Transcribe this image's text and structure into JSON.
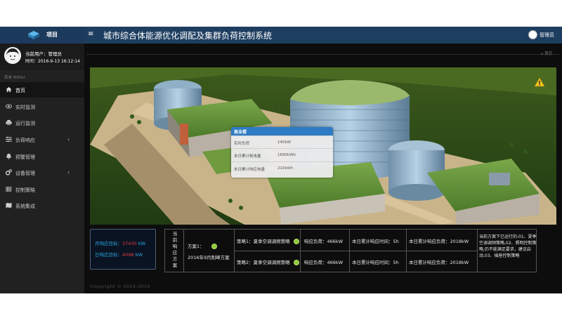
{
  "header": {
    "logo_text": "项目",
    "title": "城市综合体能源优化调配及集群负荷控制系统",
    "user_name": "管理员"
  },
  "sidebar": {
    "current_user": "当前用户：管理员",
    "time": "时间：2016-9-13 16:12:14",
    "menu_heading": "菜单 MENU",
    "items": [
      {
        "label": "首页",
        "icon": "home-icon",
        "active": true
      },
      {
        "label": "实时监测",
        "icon": "eye-icon"
      },
      {
        "label": "运行监测",
        "icon": "print-icon"
      },
      {
        "label": "负荷响应",
        "icon": "sliders-icon",
        "submenu": true
      },
      {
        "label": "预警管理",
        "icon": "bell-icon"
      },
      {
        "label": "设备管理",
        "icon": "cogs-icon",
        "submenu": true
      },
      {
        "label": "控制策略",
        "icon": "barcode-icon"
      },
      {
        "label": "系统集成",
        "icon": "map-icon"
      }
    ]
  },
  "breadcrumb": {
    "home": "首页"
  },
  "popup": {
    "title": "商业楼",
    "rows": [
      {
        "key": "实时负荷",
        "value": "140kW"
      },
      {
        "key": "本日累计耗电量",
        "value": "1690kWh"
      },
      {
        "key": "本日累计响应电量",
        "value": "210kWh"
      }
    ]
  },
  "targets": {
    "monthly_label": "月响应目标：",
    "monthly_value": "37430",
    "monthly_unit": "KW",
    "daily_label": "日响应目标：",
    "daily_value": "4098",
    "daily_unit": "KW"
  },
  "plan": {
    "side_label": "当前响应方案",
    "scheme_label": "方案1：",
    "scheme_sub": "2016年9月削峰方案",
    "strategies": [
      {
        "name": "策略1：夏季空调调频策略",
        "load": "响应负荷：466kW",
        "time": "本日累计响应时间：5h",
        "energy": "本日累计响应负荷：2018kW"
      },
      {
        "name": "策略2：夏季空调调频策略",
        "load": "响应负荷：466kW",
        "time": "本日累计响应时间：5h",
        "energy": "本日累计响应负荷：2018kW"
      }
    ],
    "note": "当前方案下已运行的:01、夏季空调调频策略,02、照明控制策略,仍不能满足要求，建议启动,03、插座控制策略"
  },
  "footer": "Copyright © 2014-2016"
}
